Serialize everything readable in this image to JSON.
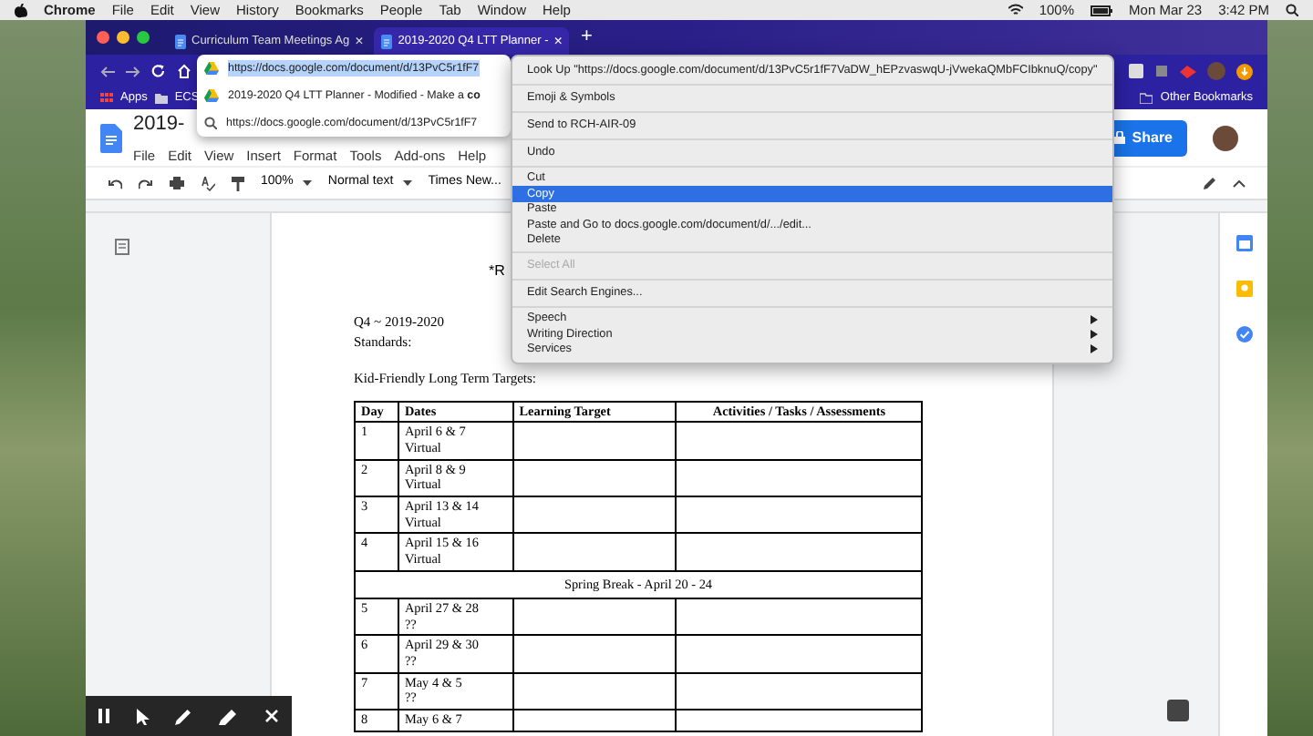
{
  "menubar": {
    "app": "Chrome",
    "menus": [
      "File",
      "Edit",
      "View",
      "History",
      "Bookmarks",
      "People",
      "Tab",
      "Window",
      "Help"
    ],
    "battery": "100%",
    "date": "Mon Mar 23",
    "time": "3:42 PM"
  },
  "browser": {
    "tabs": [
      {
        "title": "Curriculum Team Meetings Ag",
        "close": "×",
        "selected": false
      },
      {
        "title": "2019-2020 Q4 LTT Planner -",
        "close": "×",
        "selected": true
      }
    ],
    "new_tab": "+",
    "address_dropdown": {
      "value": "https://docs.google.com/document/d/13PvC5r1fF7",
      "suggestions": [
        {
          "kind": "document",
          "text": "2019-2020 Q4 LTT Planner - Modified - Make a **co**"
        },
        {
          "kind": "search",
          "text": "https://docs.google.com/document/d/13PvC5r1fF7"
        }
      ]
    },
    "bookmarks": [
      "Apps",
      "ECS"
    ],
    "other_bookmarks": "Other Bookmarks"
  },
  "docs": {
    "title": "2019-",
    "menus": [
      "File",
      "Edit",
      "View",
      "Insert",
      "Format",
      "Tools",
      "Add-ons",
      "Help"
    ],
    "zoom": "100%",
    "style": "Normal text",
    "font": "Times New...",
    "share": "Share"
  },
  "document": {
    "heading": "*R",
    "lines": [
      "Q4 ~ 2019-2020",
      "Standards:"
    ],
    "targets": "Kid-Friendly Long Term Targets:",
    "table": {
      "columns": [
        "Day",
        "Dates",
        "Learning Target",
        "Activities / Tasks / Assessments"
      ],
      "rows": [
        {
          "kind": "day",
          "day": "1",
          "dates": [
            "April 6 & 7",
            "Virtual"
          ]
        },
        {
          "kind": "day",
          "day": "2",
          "dates": [
            "April 8 & 9",
            "Virtual"
          ]
        },
        {
          "kind": "day",
          "day": "3",
          "dates": [
            "April 13 & 14",
            "Virtual"
          ]
        },
        {
          "kind": "day",
          "day": "4",
          "dates": [
            "April 15 & 16",
            "Virtual"
          ]
        },
        {
          "kind": "break",
          "text": "Spring Break -  April 20 - 24"
        },
        {
          "kind": "day",
          "day": "5",
          "dates": [
            "April 27 & 28",
            "??"
          ]
        },
        {
          "kind": "day",
          "day": "6",
          "dates": [
            "April 29 & 30",
            "??"
          ]
        },
        {
          "kind": "day",
          "day": "7",
          "dates": [
            "May 4 & 5",
            "??"
          ]
        },
        {
          "kind": "day",
          "day": "8",
          "dates": [
            "May 6 & 7"
          ]
        }
      ]
    }
  },
  "context_menu": {
    "groups": [
      [
        {
          "label": "Look Up \"https://docs.google.com/document/d/13PvC5r1fF7VaDW_hEPzvaswqU-jVwekaQMbFCIbknuQ/copy\"",
          "selected": false,
          "disabled": false,
          "submenu": false
        }
      ],
      [
        {
          "label": "Emoji & Symbols",
          "selected": false,
          "disabled": false,
          "submenu": false
        }
      ],
      [
        {
          "label": "Send to RCH-AIR-09",
          "selected": false,
          "disabled": false,
          "submenu": false
        }
      ],
      [
        {
          "label": "Undo",
          "selected": false,
          "disabled": false,
          "submenu": false
        }
      ],
      [
        {
          "label": "Cut",
          "selected": false,
          "disabled": false,
          "submenu": false
        },
        {
          "label": "Copy",
          "selected": true,
          "disabled": false,
          "submenu": false
        },
        {
          "label": "Paste",
          "selected": false,
          "disabled": false,
          "submenu": false
        },
        {
          "label": "Paste and Go to docs.google.com/document/d/.../edit...",
          "selected": false,
          "disabled": false,
          "submenu": false
        },
        {
          "label": "Delete",
          "selected": false,
          "disabled": false,
          "submenu": false
        }
      ],
      [
        {
          "label": "Select All",
          "selected": false,
          "disabled": true,
          "submenu": false
        }
      ],
      [
        {
          "label": "Edit Search Engines...",
          "selected": false,
          "disabled": false,
          "submenu": false
        }
      ],
      [
        {
          "label": "Speech",
          "selected": false,
          "disabled": false,
          "submenu": true
        },
        {
          "label": "Writing Direction",
          "selected": false,
          "disabled": false,
          "submenu": true
        },
        {
          "label": "Services",
          "selected": false,
          "disabled": false,
          "submenu": true
        }
      ]
    ]
  }
}
